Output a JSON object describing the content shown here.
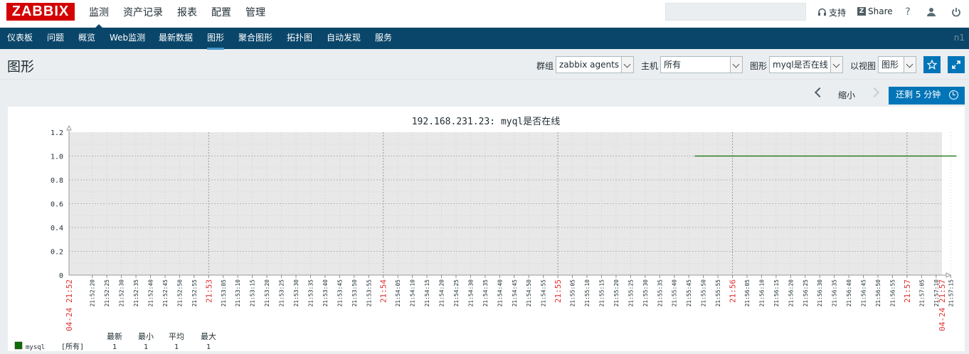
{
  "brand": "ZABBIX",
  "main_menu": [
    "监测",
    "资产记录",
    "报表",
    "配置",
    "管理"
  ],
  "top_links": {
    "support": "支持",
    "share": "Share",
    "help": "?",
    "share_badge": "Z"
  },
  "search": {
    "value": "",
    "placeholder": ""
  },
  "sub_menu": [
    "仪表板",
    "问题",
    "概览",
    "Web监测",
    "最新数据",
    "图形",
    "聚合图形",
    "拓扑图",
    "自动发现",
    "服务"
  ],
  "node_name": "n1",
  "page_title": "图形",
  "filters": {
    "group_label": "群组",
    "group_value": "zabbix agents",
    "host_label": "主机",
    "host_value": "所有",
    "graph_label": "图形",
    "graph_value": "myql是否在线",
    "view_label": "以视图",
    "view_value": "图形"
  },
  "timebar": {
    "zoom_out": "缩小",
    "remaining": "还剩 5 分钟"
  },
  "colors": {
    "accent": "#0275b8",
    "nav": "#0a466a",
    "brand": "#d40000",
    "series": "#0c6d04",
    "major_tick": "#e03030"
  },
  "chart_data": {
    "type": "line",
    "title": "192.168.231.23: myql是否在线",
    "ylim": [
      0,
      1.2
    ],
    "y_ticks": [
      "0",
      "0.2",
      "0.4",
      "0.6",
      "0.8",
      "1.0",
      "1.2"
    ],
    "x_start_label": "04-24 21:52",
    "x_end_label": "04-24 21:57",
    "x_ticks": [
      "21:52:20",
      "21:52:25",
      "21:52:30",
      "21:52:35",
      "21:52:40",
      "21:52:45",
      "21:52:50",
      "21:52:55",
      "21:53:00",
      "21:53:05",
      "21:53:10",
      "21:53:15",
      "21:53:20",
      "21:53:25",
      "21:53:30",
      "21:53:35",
      "21:53:40",
      "21:53:45",
      "21:53:50",
      "21:53:55",
      "21:54:00",
      "21:54:05",
      "21:54:10",
      "21:54:15",
      "21:54:20",
      "21:54:25",
      "21:54:30",
      "21:54:35",
      "21:54:40",
      "21:54:45",
      "21:54:50",
      "21:54:55",
      "21:55:00",
      "21:55:05",
      "21:55:10",
      "21:55:15",
      "21:55:20",
      "21:55:25",
      "21:55:30",
      "21:55:35",
      "21:55:40",
      "21:55:45",
      "21:55:50",
      "21:55:55",
      "21:56:00",
      "21:56:05",
      "21:56:10",
      "21:56:15",
      "21:56:20",
      "21:56:25",
      "21:56:30",
      "21:56:35",
      "21:56:40",
      "21:56:45",
      "21:56:50",
      "21:56:55",
      "21:57:00",
      "21:57:05",
      "21:57:10",
      "21:57:15"
    ],
    "series": [
      {
        "name": "mysql",
        "host": "[所有]",
        "color": "#0c6d04",
        "segment": {
          "from": "21:55:47",
          "to": "21:57:17",
          "value": 1
        }
      }
    ],
    "legend": {
      "headers": [
        "最新",
        "最小",
        "平均",
        "最大"
      ],
      "rows": [
        {
          "name": "mysql",
          "host": "[所有]",
          "last": "1",
          "min": "1",
          "avg": "1",
          "max": "1"
        }
      ]
    }
  }
}
